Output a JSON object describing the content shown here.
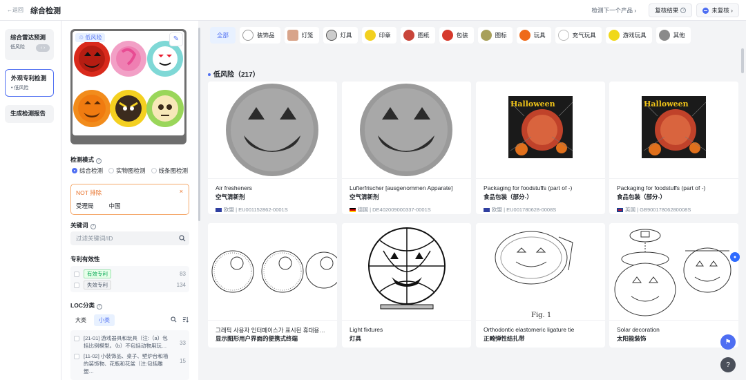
{
  "header": {
    "back_label": "←返回",
    "title": "综合检测",
    "next_product": "检测下一个产品",
    "review_result": "复核结果",
    "review_status": "未复核"
  },
  "leftnav": [
    {
      "title": "综合雷达预测",
      "sub": "低风险",
      "toggle": "‹ ›"
    },
    {
      "title": "外观专利检测",
      "sub": "• 低风险"
    },
    {
      "title": "生成检测报告"
    }
  ],
  "panel": {
    "preview_badge": "低风险",
    "mode_title": "检测模式",
    "modes": [
      "综合检测",
      "实物图检测",
      "线条图检测"
    ],
    "not_title": "NOT 排除",
    "not_key": "受理局",
    "not_value": "中国",
    "keyword_title": "关键词",
    "keyword_placeholder": "过滤关键词/ID",
    "validity_title": "专利有效性",
    "validity": [
      {
        "label": "有效专利",
        "count": "83"
      },
      {
        "label": "失效专利",
        "count": "134"
      }
    ],
    "loc_title": "LOC分类",
    "loc_tabs": [
      "大类",
      "小类"
    ],
    "loc_items": [
      {
        "text": "[21-01] 游戏器具和玩具（注:（a）包括比例模型。（b）不包括动物用玩…",
        "count": "33"
      },
      {
        "text": "[11-02] 小装饰品、桌子、壁炉台和墙的装饰物、花瓶和花盆（注:包括雕塑…",
        "count": "15"
      }
    ]
  },
  "filters": [
    "全部",
    "装饰品",
    "灯笼",
    "灯具",
    "印章",
    "图纸",
    "包装",
    "图标",
    "玩具",
    "充气玩具",
    "游戏玩具",
    "其他"
  ],
  "section": "低风险（217）",
  "cards": [
    {
      "en": "Air fresheners",
      "zh": "空气清新剂",
      "country": "欧盟",
      "id": "EU001152862-0001S"
    },
    {
      "en": "Lufterfrischer [ausgenommen Apparate]",
      "zh": "空气清新剂",
      "country": "德国",
      "id": "DE402009000337-0001S"
    },
    {
      "en": "Packaging for foodstuffs (part of -)",
      "zh": "食品包装（部分-）",
      "country": "欧盟",
      "id": "EU001780628-0008S",
      "img_text": "Halloween"
    },
    {
      "en": "Packaging for foodstuffs (part of -)",
      "zh": "食品包装（部分-）",
      "country": "英国",
      "id": "GB90017806280008S",
      "img_text": "Halloween"
    },
    {
      "en": "그래픽 사용자 인터페이스가 표시된 휴대용…",
      "zh": "显示图形用户界面的便携式终端"
    },
    {
      "en": "Light fixtures",
      "zh": "灯具"
    },
    {
      "en": "Orthodontic elastomeric ligature tie",
      "zh": "正畸弹性结扎带",
      "img_text": "Fig. 1"
    },
    {
      "en": "Solar decoration",
      "zh": "太阳能装饰"
    }
  ],
  "colors": {
    "accent": "#4e6ef2",
    "warn": "#e8722a",
    "ok": "#00a650"
  }
}
